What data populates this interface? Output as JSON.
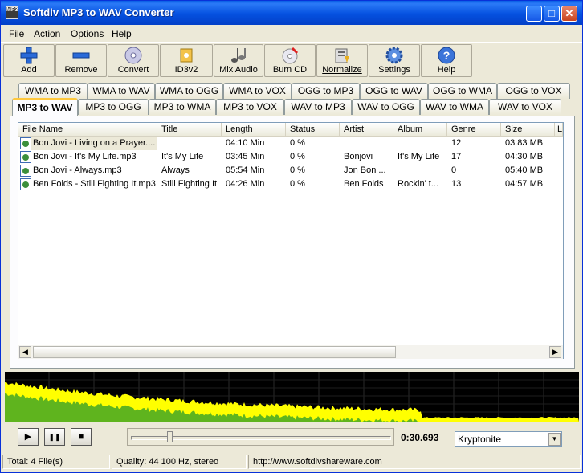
{
  "window": {
    "title": "Softdiv MP3 to WAV Converter",
    "icon_text": "MP3",
    "min_glyph": "_",
    "max_glyph": "□",
    "close_glyph": "✕"
  },
  "menu": [
    "File",
    "Action",
    "Options",
    "Help"
  ],
  "toolbar": [
    {
      "label": "Add",
      "icon": "plus-icon"
    },
    {
      "label": "Remove",
      "icon": "minus-icon"
    },
    {
      "label": "Convert",
      "icon": "disc-icon"
    },
    {
      "label": "ID3v2",
      "icon": "id3-tag-icon"
    },
    {
      "label": "Mix Audio",
      "icon": "mix-notes-icon"
    },
    {
      "label": "Burn CD",
      "icon": "burn-cd-icon"
    },
    {
      "label": "Normalize",
      "icon": "normalize-icon"
    },
    {
      "label": "Settings",
      "icon": "gear-icon"
    },
    {
      "label": "Help",
      "icon": "help-icon"
    }
  ],
  "tabs_row1": [
    "WMA to MP3",
    "WMA to WAV",
    "WMA to OGG",
    "WMA to VOX",
    "OGG to MP3",
    "OGG to WAV",
    "OGG to WMA",
    "OGG to VOX"
  ],
  "tabs_row2": [
    "MP3 to WAV",
    "MP3 to OGG",
    "MP3 to WMA",
    "MP3 to VOX",
    "WAV to MP3",
    "WAV to OGG",
    "WAV to WMA",
    "WAV to VOX"
  ],
  "columns": [
    "File Name",
    "Title",
    "Length",
    "Status",
    "Artist",
    "Album",
    "Genre",
    "Size",
    "L"
  ],
  "files": [
    {
      "name": "Bon Jovi - Living on a Prayer....",
      "title": "",
      "length": "04:10 Min",
      "status": "0 %",
      "artist": "",
      "album": "",
      "genre": "12",
      "size": "03:83 MB"
    },
    {
      "name": "Bon Jovi - It's My Life.mp3",
      "title": "It's My Life",
      "length": "03:45 Min",
      "status": "0 %",
      "artist": "Bonjovi",
      "album": "It's My Life",
      "genre": "17",
      "size": "04:30 MB"
    },
    {
      "name": "Bon Jovi - Always.mp3",
      "title": "Always",
      "length": "05:54 Min",
      "status": "0 %",
      "artist": "Jon Bon ...",
      "album": "",
      "genre": "0",
      "size": "05:40 MB"
    },
    {
      "name": "Ben Folds - Still Fighting It.mp3",
      "title": "Still Fighting It",
      "length": "04:26 Min",
      "status": "0 %",
      "artist": "Ben Folds",
      "album": "Rockin' t...",
      "genre": "13",
      "size": "04:57 MB"
    }
  ],
  "player": {
    "play": "▶",
    "pause": "❚❚",
    "stop": "■",
    "time": "0:30.693",
    "seek_fraction": 0.14,
    "skin": "Kryptonite"
  },
  "status": {
    "total": "Total: 4 File(s)",
    "quality": "Quality: 44 100 Hz, stereo",
    "url": "http://www.softdivshareware.com"
  },
  "colors": {
    "title_bar": "#0551e0",
    "spectrum_top": "#ffff00",
    "spectrum_low": "#5fb41e"
  }
}
